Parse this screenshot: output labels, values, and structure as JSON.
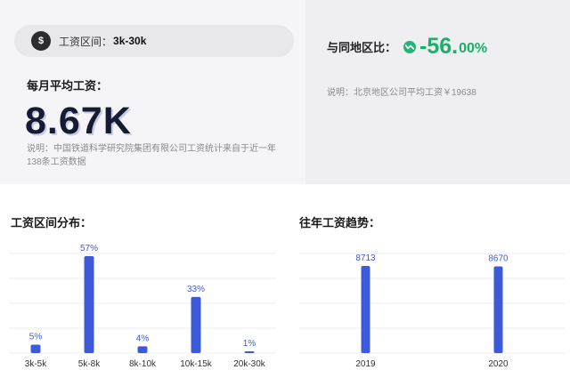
{
  "salary_range": {
    "icon": "money-bag-icon",
    "label": "工资区间：",
    "value": "3k-30k"
  },
  "average": {
    "title": "每月平均工资：",
    "value": "8.67K",
    "note": "说明：中国铁道科学研究院集团有限公司工资统计来自于近一年138条工资数据"
  },
  "comparison": {
    "label": "与同地区比：",
    "icon": "trend-down-icon",
    "value_main": "-56.",
    "value_decimal": "00%",
    "note": "说明：北京地区公司平均工资￥19638"
  },
  "colors": {
    "bar": "#3d5bd9",
    "accent_green": "#17b26a"
  },
  "chart_data": [
    {
      "type": "bar",
      "title": "工资区间分布：",
      "categories": [
        "3k-5k",
        "5k-8k",
        "8k-10k",
        "10k-15k",
        "20k-30k"
      ],
      "values": [
        5,
        57,
        4,
        33,
        1
      ],
      "labels": [
        "5%",
        "57%",
        "4%",
        "33%",
        "1%"
      ],
      "ylim": [
        0,
        57
      ],
      "grid": true
    },
    {
      "type": "bar",
      "title": "往年工资趋势：",
      "categories": [
        "2019",
        "2020"
      ],
      "values": [
        8713,
        8670
      ],
      "labels": [
        "8713",
        "8670"
      ],
      "ylim": [
        0,
        8713
      ],
      "grid": true
    }
  ]
}
